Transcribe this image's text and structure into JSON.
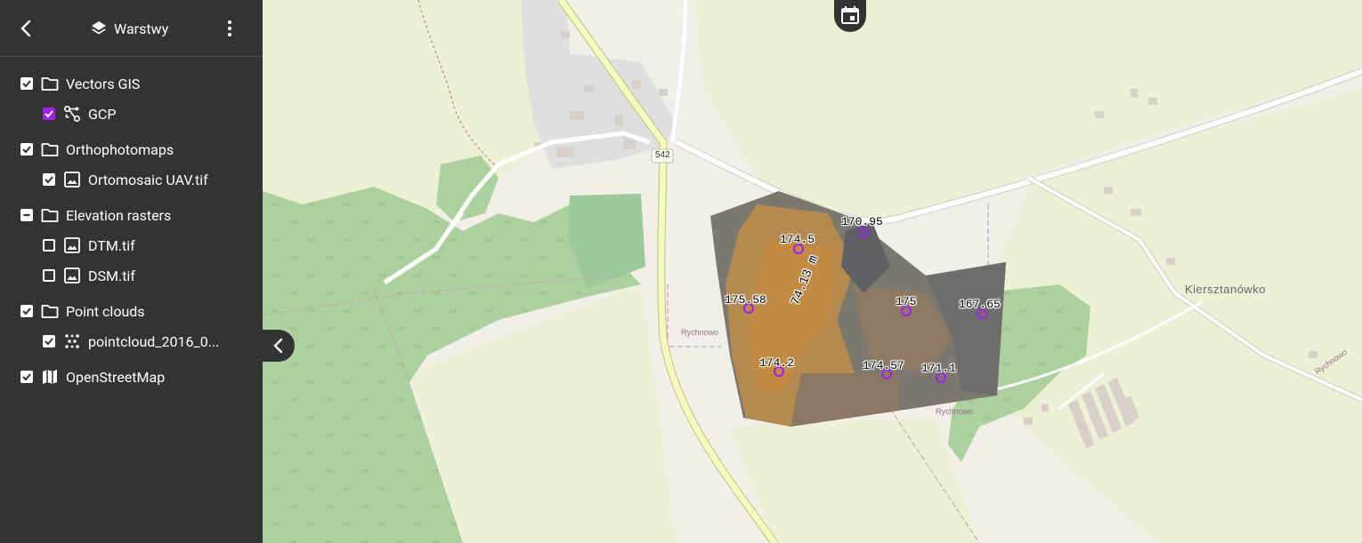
{
  "header": {
    "title": "Warstwy"
  },
  "layers": [
    {
      "label": "Vectors GIS",
      "state": "checked",
      "icon": "folder-icon",
      "indent": 0
    },
    {
      "label": "GCP",
      "state": "purple",
      "icon": "vector-path-icon",
      "indent": 1
    },
    {
      "label": "Orthophotomaps",
      "state": "checked",
      "icon": "folder-icon",
      "indent": 0
    },
    {
      "label": "Ortomosaic UAV.tif",
      "state": "checked",
      "icon": "image-icon",
      "indent": 1
    },
    {
      "label": "Elevation rasters",
      "state": "indeterminate",
      "icon": "folder-icon",
      "indent": 0
    },
    {
      "label": "DTM.tif",
      "state": "unchecked",
      "icon": "image-icon",
      "indent": 1
    },
    {
      "label": "DSM.tif",
      "state": "unchecked",
      "icon": "image-icon",
      "indent": 1
    },
    {
      "label": "Point clouds",
      "state": "checked",
      "icon": "folder-icon",
      "indent": 0
    },
    {
      "label": "pointcloud_2016_0...",
      "state": "checked",
      "icon": "pointcloud-icon",
      "indent": 1
    },
    {
      "label": "OpenStreetMap",
      "state": "checked",
      "icon": "map-icon",
      "indent": 0
    }
  ],
  "map": {
    "road_number": "542",
    "measurement": "74.13 m",
    "place_labels": [
      "Kiersztanówko",
      "Rychnowo",
      "Rychnowo",
      "Rychnowo"
    ],
    "gcp_points": [
      {
        "label": "170.95"
      },
      {
        "label": "174.5"
      },
      {
        "label": "175.58"
      },
      {
        "label": "175"
      },
      {
        "label": "167.65"
      },
      {
        "label": "174.2"
      },
      {
        "label": "174.57"
      },
      {
        "label": "171.1"
      }
    ]
  },
  "colors": {
    "sidebar": "#333333",
    "gcp": "#a21df0",
    "forest": "#add19e",
    "farmland": "#eef0d5",
    "road_major": "#f7fabf"
  }
}
